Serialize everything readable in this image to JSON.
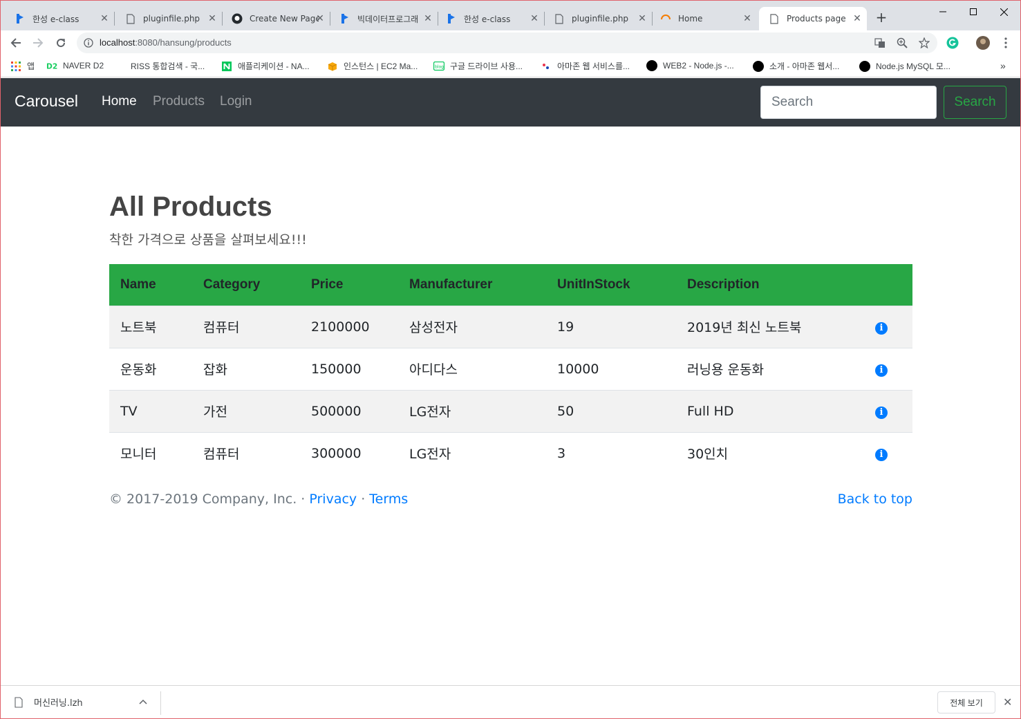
{
  "browser": {
    "tabs": [
      {
        "title": "한성 e-class",
        "favicon": "bracket-b-icon"
      },
      {
        "title": "pluginfile.php",
        "favicon": "page-icon"
      },
      {
        "title": "Create New Page",
        "favicon": "github-icon"
      },
      {
        "title": "빅데이터프로그래",
        "favicon": "bracket-b-icon"
      },
      {
        "title": "한성 e-class",
        "favicon": "bracket-b-icon"
      },
      {
        "title": "pluginfile.php",
        "favicon": "page-icon"
      },
      {
        "title": "Home",
        "favicon": "loading-icon"
      },
      {
        "title": "Products page",
        "favicon": "page-icon",
        "active": true
      }
    ],
    "url_host": "localhost",
    "url_rest": ":8080/hansung/products",
    "bookmarks": [
      {
        "label": "앱",
        "icon": "apps-grid-icon"
      },
      {
        "label": "NAVER D2",
        "icon": "d2-icon"
      },
      {
        "label": "RISS 통합검색 - 국...",
        "icon": "riss-icon"
      },
      {
        "label": "애플리케이션 - NA...",
        "icon": "naver-n-icon"
      },
      {
        "label": "인스턴스 | EC2 Ma...",
        "icon": "aws-box-icon"
      },
      {
        "label": "구글 드라이브 사용...",
        "icon": "blog-icon"
      },
      {
        "label": "아마존 웹 서비스를...",
        "icon": "dots-icon"
      },
      {
        "label": "WEB2 - Node.js -...",
        "icon": "black-circle-icon"
      },
      {
        "label": "소개 - 아마존 웹서...",
        "icon": "black-circle-icon"
      },
      {
        "label": "Node.js MySQL 모...",
        "icon": "black-circle-icon"
      }
    ]
  },
  "navbar": {
    "brand": "Carousel",
    "links": [
      {
        "label": "Home",
        "active": true
      },
      {
        "label": "Products",
        "active": false
      },
      {
        "label": "Login",
        "active": false
      }
    ],
    "search_placeholder": "Search",
    "search_button": "Search"
  },
  "main": {
    "title": "All Products",
    "subtitle": "착한 가격으로 상품을 살펴보세요!!!"
  },
  "table": {
    "headers": [
      "Name",
      "Category",
      "Price",
      "Manufacturer",
      "UnitInStock",
      "Description"
    ],
    "rows": [
      [
        "노트북",
        "컴퓨터",
        "2100000",
        "삼성전자",
        "19",
        "2019년 최신 노트북"
      ],
      [
        "운동화",
        "잡화",
        "150000",
        "아디다스",
        "10000",
        "러닝용 운동화"
      ],
      [
        "TV",
        "가전",
        "500000",
        "LG전자",
        "50",
        "Full HD"
      ],
      [
        "모니터",
        "컴퓨터",
        "300000",
        "LG전자",
        "3",
        "30인치"
      ]
    ]
  },
  "footer": {
    "copyright": "© 2017-2019 Company, Inc. · ",
    "privacy": "Privacy",
    "dot": " · ",
    "terms": "Terms",
    "back_to_top": "Back to top"
  },
  "download_bar": {
    "file": "머신러닝.lzh",
    "show_all": "전체 보기"
  },
  "colors": {
    "navbar_bg": "#343a40",
    "table_header_bg": "#28a745",
    "link": "#007bff",
    "success": "#28a745"
  }
}
